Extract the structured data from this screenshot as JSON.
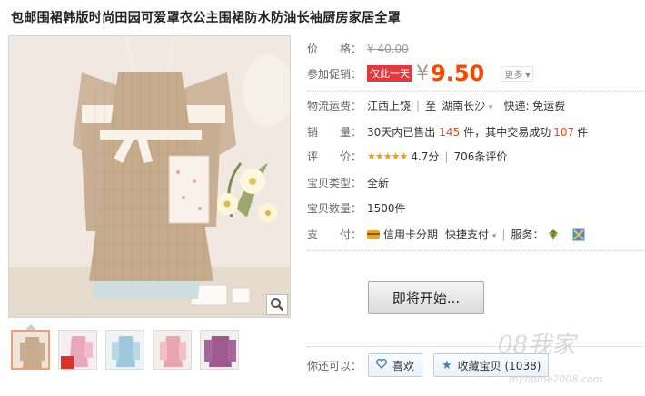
{
  "title": "包邮围裙韩版时尚田园可爱罩衣公主围裙防水防油长袖厨房家居全罩",
  "price": {
    "label": "价　　格：",
    "original": "¥ 40.00"
  },
  "promo": {
    "label": "参加促销：",
    "tag": "仅此一天",
    "yen": "¥",
    "price": "9.50",
    "more": "更多"
  },
  "shipping": {
    "label": "物流运费：",
    "from": "江西上饶",
    "to_word": "至",
    "to": "湖南长沙",
    "express": "快递: 免运费"
  },
  "sales": {
    "label": "销　　量：",
    "text_a": "30天内已售出",
    "sold": "145",
    "text_b": "件，其中交易成功",
    "success": "107",
    "text_c": "件"
  },
  "rating": {
    "label": "评　　价：",
    "stars": "★★★★★",
    "score": "4.7分",
    "reviews": "706条评价"
  },
  "type": {
    "label": "宝贝类型：",
    "value": "全新"
  },
  "quantity": {
    "label": "宝贝数量：",
    "value": "1500件"
  },
  "payment": {
    "label": "支　　付：",
    "credit": "信用卡分期",
    "quick": "快捷支付",
    "service_label": "服务："
  },
  "action": {
    "coming": "即将开始..."
  },
  "you_can": {
    "label": "你还可以：",
    "like": "喜欢",
    "collect": "收藏宝贝 (1038)"
  },
  "watermark": {
    "logo": "08我家",
    "url": "myhome2008.com"
  },
  "colors": {
    "accent": "#ff4400",
    "promo_tag": "#e4393c",
    "star": "#ff9900"
  }
}
